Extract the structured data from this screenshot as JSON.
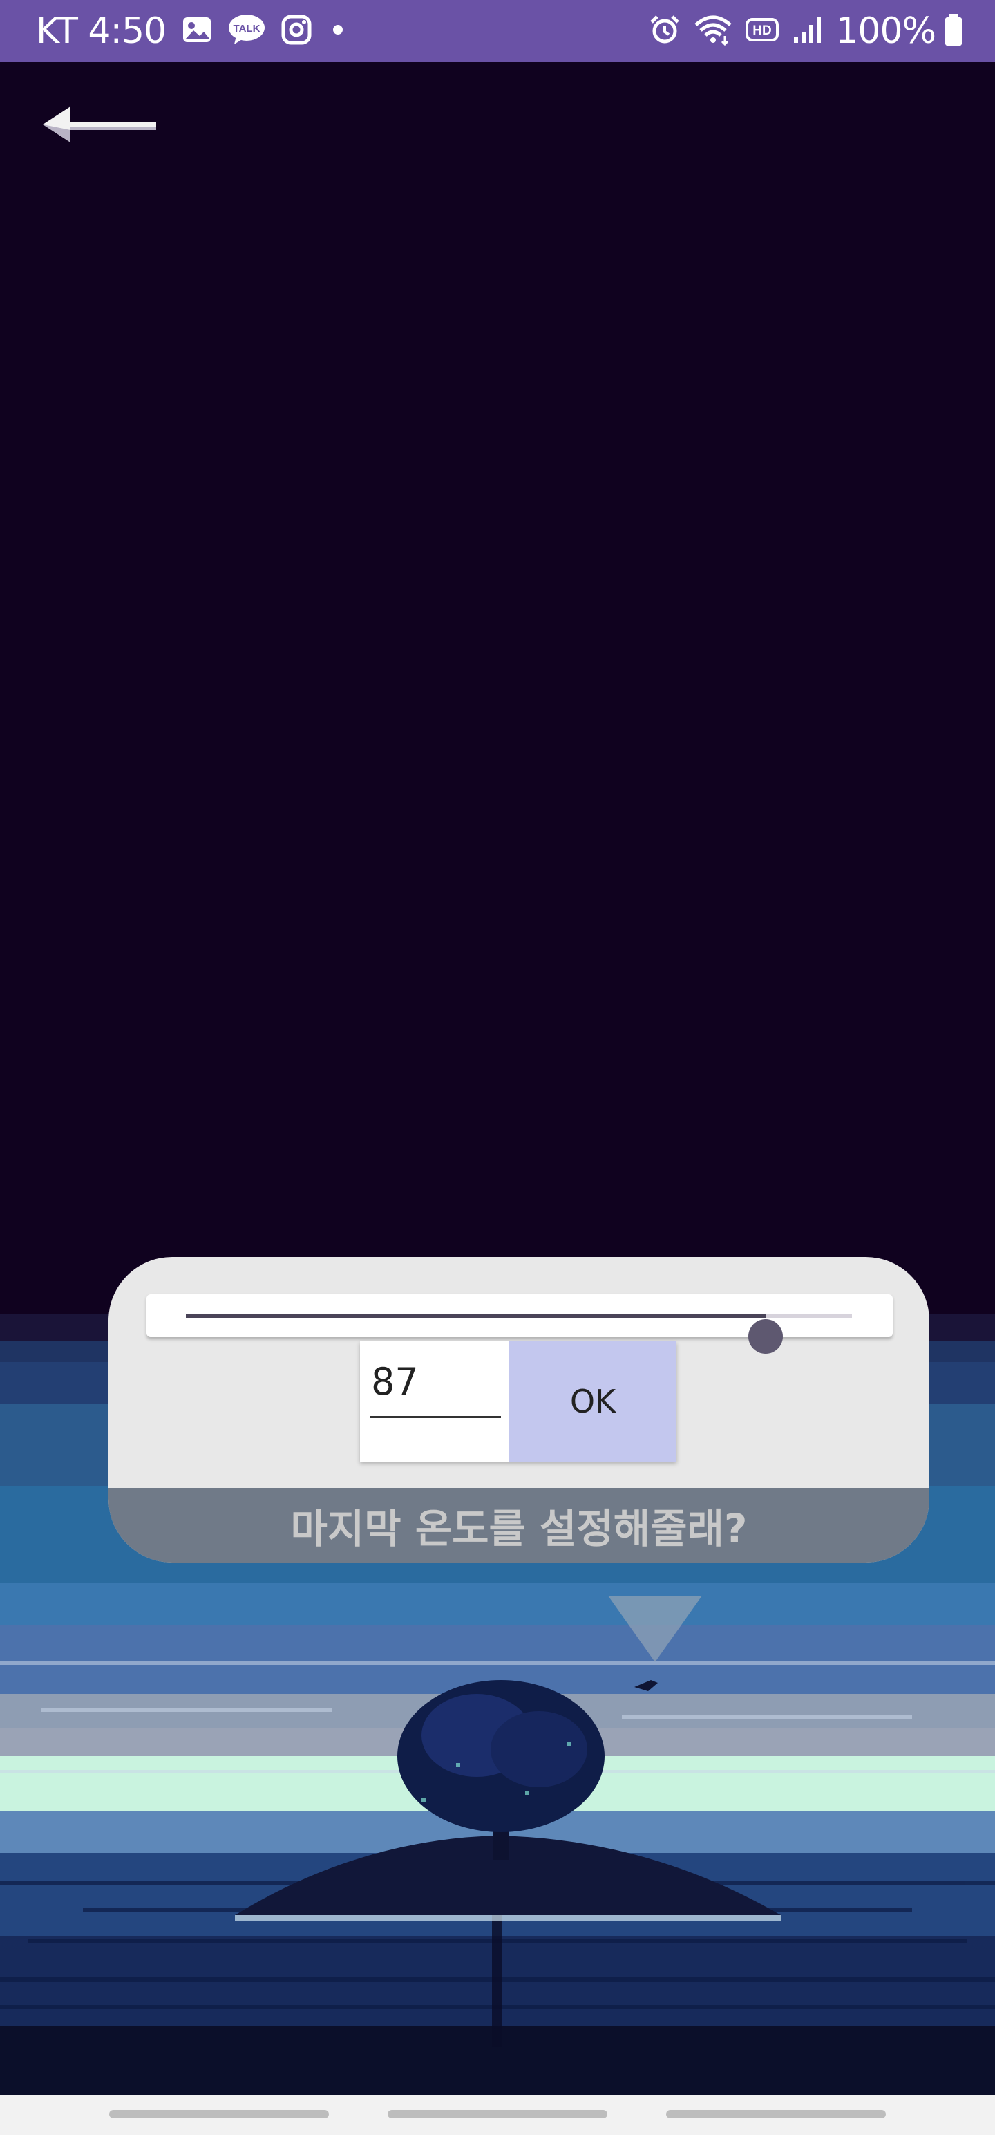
{
  "status_bar": {
    "carrier_time": "KT 4:50",
    "battery": "100%",
    "left_icons": [
      "gallery-icon",
      "kakaotalk-icon",
      "instagram-icon",
      "dot-icon"
    ],
    "right_icons": [
      "alarm-icon",
      "wifi-icon",
      "hd-icon",
      "signal-icon",
      "battery-icon"
    ],
    "talk_badge": "TALK",
    "hd_badge": "HD"
  },
  "header": {
    "back_icon": "back-arrow-icon"
  },
  "dialog": {
    "slider_value": 87,
    "slider_max": 100,
    "value": "87",
    "ok_label": "OK",
    "prompt": "마지막 온도를 설정해줄래?"
  },
  "colors": {
    "status_bar_bg": "#6a52a6",
    "page_bg": "#10021f",
    "dialog_bg": "#e8e8e8",
    "ok_button_bg": "#c3c7ee"
  }
}
